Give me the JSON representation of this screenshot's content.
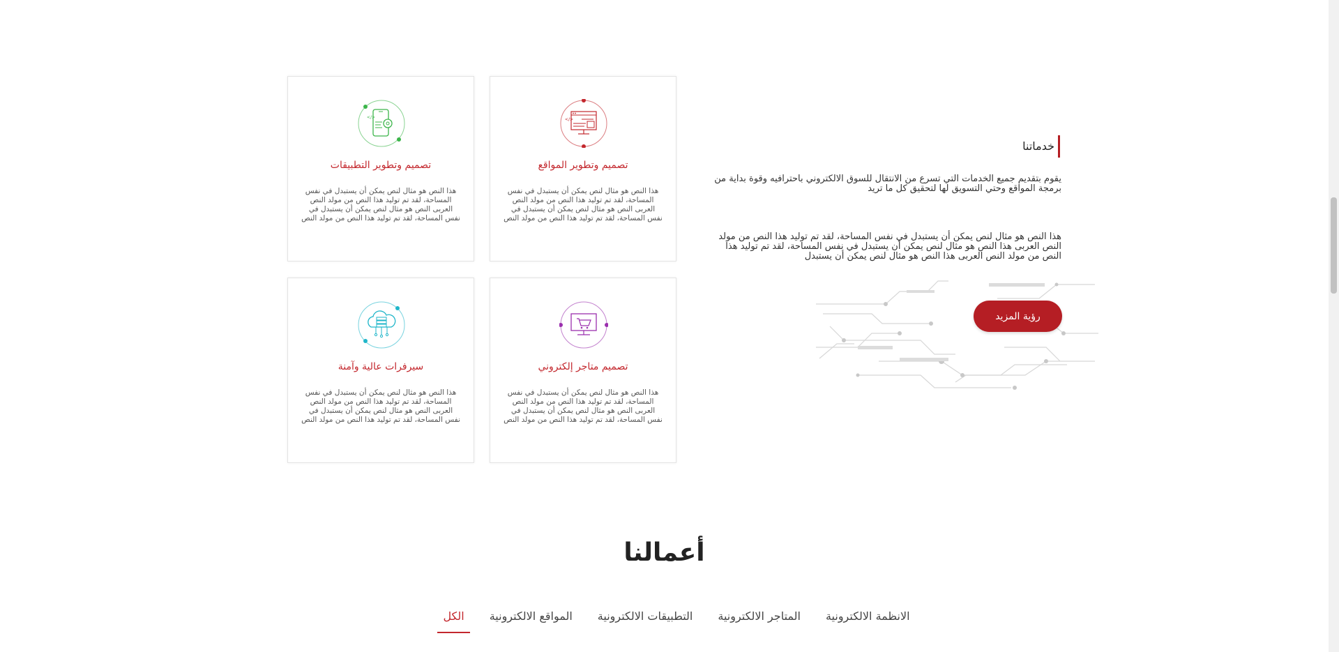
{
  "services": {
    "cards": [
      {
        "title": "تصميم وتطوير المواقع",
        "desc": "هذا النص هو مثال لنص يمكن أن يستبدل في نفس المساحة، لقد تم توليد هذا النص من مولد النص العربى النص هو مثال لنص يمكن أن يستبدل في نفس المساحة، لقد تم توليد هذا النص من مولد النص"
      },
      {
        "title": "تصميم وتطوير التطبيقات",
        "desc": "هذا النص هو مثال لنص يمكن أن يستبدل في نفس المساحة، لقد تم توليد هذا النص من مولد النص العربى النص هو مثال لنص يمكن أن يستبدل في نفس المساحة، لقد تم توليد هذا النص من مولد النص"
      },
      {
        "title": "تصميم متاجر إلكتروني",
        "desc": "هذا النص هو مثال لنص يمكن أن يستبدل في نفس المساحة، لقد تم توليد هذا النص من مولد النص العربى النص هو مثال لنص يمكن أن يستبدل في نفس المساحة، لقد تم توليد هذا النص من مولد النص"
      },
      {
        "title": "سيرفرات عالية وآمنة",
        "desc": "هذا النص هو مثال لنص يمكن أن يستبدل في نفس المساحة، لقد تم توليد هذا النص من مولد النص العربى النص هو مثال لنص يمكن أن يستبدل في نفس المساحة، لقد تم توليد هذا النص من مولد النص"
      }
    ],
    "icons": [
      "web-development-icon",
      "app-development-icon",
      "ecommerce-cart-icon",
      "cloud-server-icon"
    ],
    "colors": {
      "red": "#c3272d",
      "green": "#3cb54a",
      "purple": "#9b2fae",
      "cyan": "#1fb6c9"
    }
  },
  "intro": {
    "label": "خدماتنا",
    "p1": "يقوم بتقديم جميع الخدمات التي تسرع من الانتقال للسوق الالكتروني باحترافيه وقوة بداية من برمجة المواقع وحتي التسويق لها لتحقيق كل ما تريد",
    "p2": "هذا النص هو مثال لنص يمكن أن يستبدل في نفس المساحة، لقد تم توليد هذا النص من مولد النص العربى هذا النص هو مثال لنص يمكن أن يستبدل في نفس المساحة، لقد تم توليد هذا النص من مولد النص العربى هذا النص هو مثال لنص يمكن أن يستبدل",
    "button": "رؤية المزيد"
  },
  "works": {
    "title": "أعمالنا",
    "tabs": [
      "الكل",
      "المواقع الالكترونية",
      "التطبيقات الالكترونية",
      "المتاجر الالكترونية",
      "الانظمة الالكترونية"
    ],
    "active_tab": "الكل"
  },
  "theme": {
    "accent": "#b51e24"
  }
}
